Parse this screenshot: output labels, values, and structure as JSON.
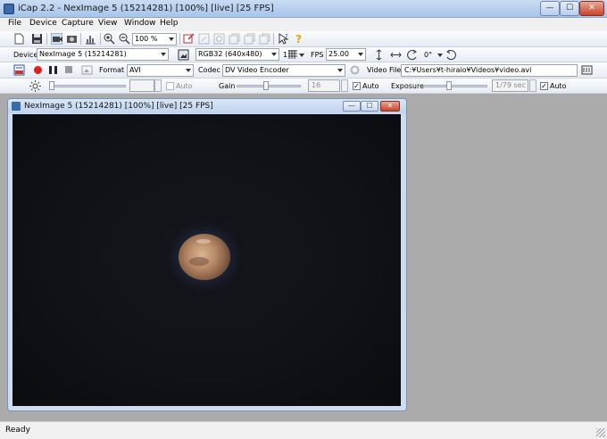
{
  "window": {
    "title": "iCap 2.2 - NexImage 5 (15214281) [100%]  [live]  [25 FPS]",
    "min_glyph": "—",
    "max_glyph": "☐",
    "close_glyph": "✕"
  },
  "menu": [
    "File",
    "Device",
    "Capture",
    "View",
    "Window",
    "Help"
  ],
  "toolbar1": {
    "zoom": "100 %"
  },
  "toolbar2": {
    "device_label": "Device",
    "device_value": "NexImage 5 (15214281)",
    "format_value": "RGB32 (640x480)",
    "channel_value": "1",
    "fps_label": "FPS",
    "fps_value": "25.00",
    "rotation_value": "0°"
  },
  "toolbar3": {
    "format_label": "Format",
    "format_value": "AVI",
    "codec_label": "Codec",
    "codec_value": "DV Video Encoder",
    "videofile_label": "Video File",
    "videofile_value": "C:¥Users¥t-hiraio¥Videos¥video.avi"
  },
  "toolbar4": {
    "brightness_auto_label": "Auto",
    "gain_label": "Gain",
    "gain_value": "16",
    "gain_auto_label": "Auto",
    "exposure_label": "Exposure",
    "exposure_value": "1/79 sec",
    "exposure_auto_label": "Auto"
  },
  "child_window": {
    "title": "NexImage 5 (15214281) [100%]  [live]  [25 FPS]",
    "min_glyph": "—",
    "max_glyph": "☐",
    "close_glyph": "✕"
  },
  "status": {
    "text": "Ready"
  },
  "colors": {
    "accent": "#3a6aa8",
    "close": "#c7442b",
    "record": "#e02020"
  }
}
